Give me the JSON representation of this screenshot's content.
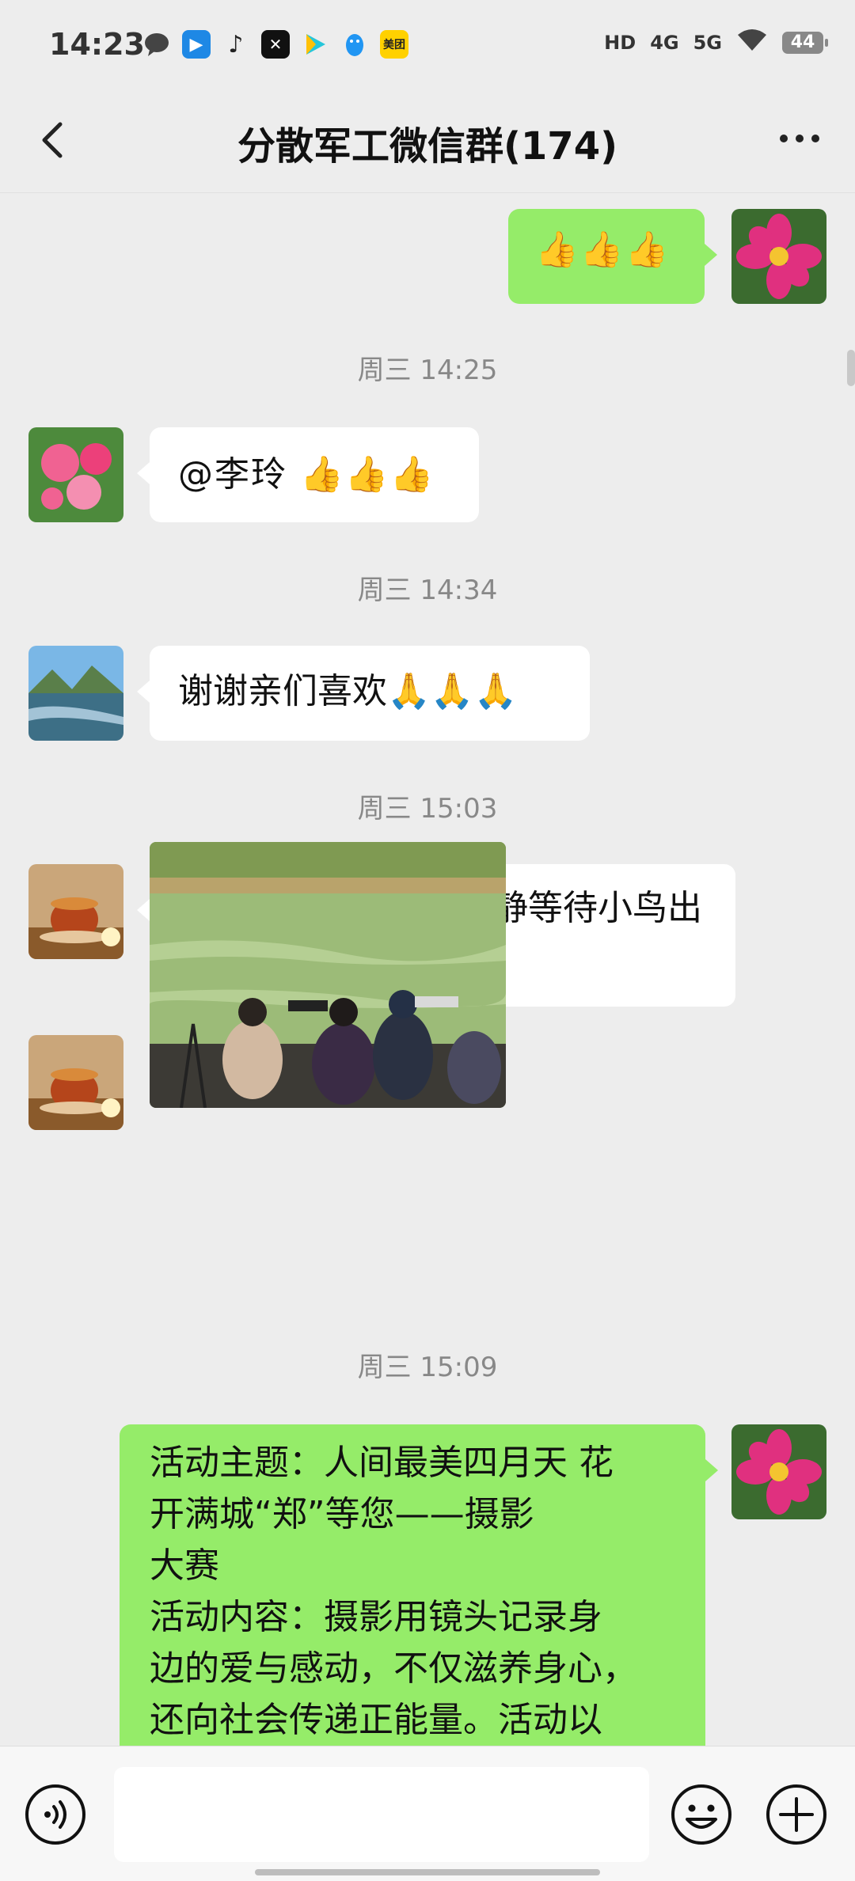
{
  "status_bar": {
    "time": "14:23",
    "network_labels": [
      "HD",
      "4G",
      "5G"
    ],
    "battery": "44",
    "meituan_label": "美团"
  },
  "nav": {
    "title": "分散军工微信群(174)"
  },
  "messages": [
    {
      "type": "text",
      "side": "out",
      "text": "👍👍👍",
      "avatar_icon": "pink-cosmos-flower-avatar"
    },
    {
      "type": "timestamp",
      "text": "周三 14:25"
    },
    {
      "type": "text",
      "side": "in",
      "text": "@李玲 👍👍👍",
      "avatar_icon": "pink-roses-avatar"
    },
    {
      "type": "timestamp",
      "text": "周三 14:34"
    },
    {
      "type": "text",
      "side": "in",
      "text": "谢谢亲们喜欢🙏🙏🙏",
      "avatar_icon": "mountain-river-avatar"
    },
    {
      "type": "timestamp",
      "text": "周三 15:03"
    },
    {
      "type": "text",
      "side": "in",
      "text": "龙子湖摄影爱好者静静等待小鸟出现",
      "avatar_icon": "tea-cup-avatar"
    },
    {
      "type": "image",
      "side": "in",
      "description_icon": "lake-photographers-photo",
      "avatar_icon": "tea-cup-avatar"
    },
    {
      "type": "timestamp",
      "text": "周三 15:09"
    },
    {
      "type": "text",
      "side": "out",
      "lines": [
        "活动主题：人间最美四月天 花",
        "开满城“郑”等您——摄影",
        "大赛",
        "活动内容：摄影用镜头记录身",
        "边的爱与感动，不仅滋养身心，",
        "还向社会传递正能量。活动以"
      ],
      "avatar_icon": "pink-cosmos-flower-avatar"
    }
  ],
  "input_bar": {
    "voice_icon": "voice-icon",
    "emoji_icon": "emoji-icon",
    "plus_icon": "plus-icon"
  },
  "colors": {
    "background": "#ededed",
    "outgoing_bubble": "#95ec69",
    "incoming_bubble": "#ffffff",
    "timestamp": "#888888"
  }
}
